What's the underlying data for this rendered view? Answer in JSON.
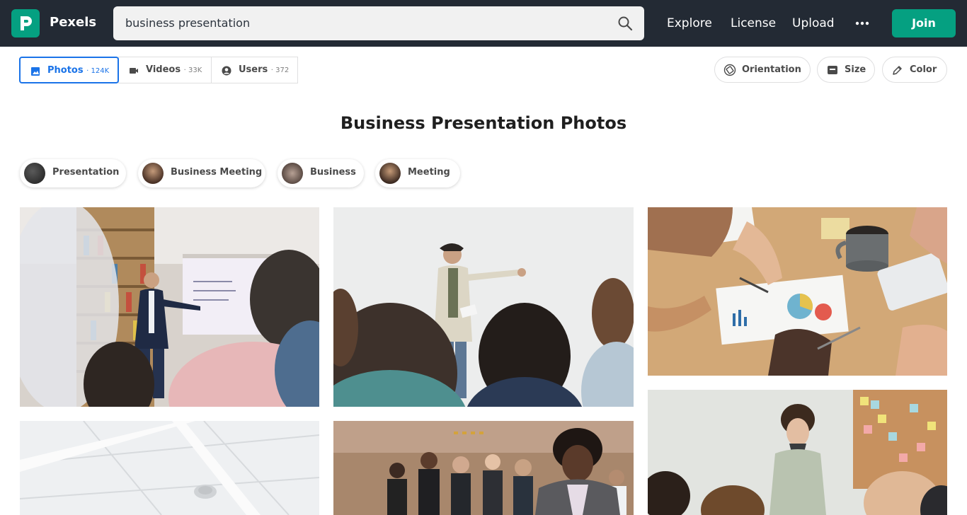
{
  "header": {
    "brand": "Pexels",
    "search_value": "business presentation",
    "nav": [
      "Explore",
      "License",
      "Upload"
    ],
    "join_label": "Join",
    "accent_color": "#05a081",
    "bar_color": "#232a34"
  },
  "type_tabs": [
    {
      "label": "Photos",
      "count": "· 124K",
      "icon": "image-icon",
      "active": true
    },
    {
      "label": "Videos",
      "count": "· 33K",
      "icon": "video-camera-icon",
      "active": false
    },
    {
      "label": "Users",
      "count": "· 372",
      "icon": "user-circle-icon",
      "active": false
    }
  ],
  "filters": [
    {
      "label": "Orientation",
      "icon": "orientation-icon"
    },
    {
      "label": "Size",
      "icon": "size-icon"
    },
    {
      "label": "Color",
      "icon": "color-picker-icon"
    }
  ],
  "page_title": "Business Presentation Photos",
  "related_searches": [
    "Presentation",
    "Business Meeting",
    "Business",
    "Meeting"
  ],
  "photos": [
    {
      "subject": "man presenting to audience in library"
    },
    {
      "subject": "man pointing at whiteboard in meeting"
    },
    {
      "subject": "hands over charts on wooden desk"
    },
    {
      "subject": "office ceiling lights"
    },
    {
      "subject": "seated conference audience"
    },
    {
      "subject": "woman standing by cork board"
    }
  ]
}
